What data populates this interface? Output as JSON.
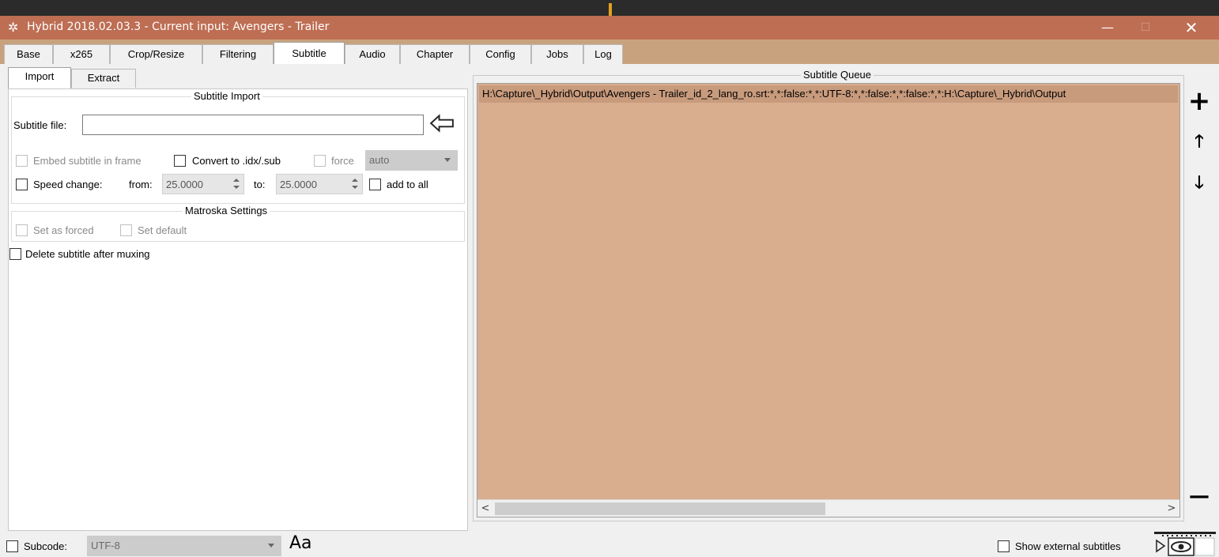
{
  "window": {
    "title": "Hybrid 2018.02.03.3 - Current input: Avengers - Trailer",
    "app_icon": "hybrid-app-icon",
    "controls": {
      "minimize": "—",
      "maximize": "☐",
      "close": "✕"
    }
  },
  "main_tabs": [
    {
      "label": "Base"
    },
    {
      "label": "x265"
    },
    {
      "label": "Crop/Resize"
    },
    {
      "label": "Filtering"
    },
    {
      "label": "Subtitle"
    },
    {
      "label": "Audio"
    },
    {
      "label": "Chapter"
    },
    {
      "label": "Config"
    },
    {
      "label": "Jobs"
    },
    {
      "label": "Log"
    }
  ],
  "active_tab": "Subtitle",
  "sub_tabs": [
    {
      "label": "Import"
    },
    {
      "label": "Extract"
    }
  ],
  "import": {
    "group_title": "Subtitle Import",
    "subtitle_file_label": "Subtitle file:",
    "subtitle_file_value": "",
    "embed_label": "Embed subtitle in frame",
    "convert_label": "Convert to .idx/.sub",
    "force_label": "force",
    "force_combo_value": "auto",
    "speed_label": "Speed change:",
    "from_label": "from:",
    "from_value": "25.0000",
    "to_label": "to:",
    "to_value": "25.0000",
    "add_to_all_label": "add to all",
    "matroska_title": "Matroska Settings",
    "set_forced_label": "Set as forced",
    "set_default_label": "Set default",
    "delete_label": "Delete subtitle after muxing"
  },
  "queue": {
    "title": "Subtitle Queue",
    "items": [
      "H:\\Capture\\_Hybrid\\Output\\Avengers - Trailer_id_2_lang_ro.srt:*,*:false:*,*:UTF-8:*,*:false:*,*:false:*,*:H:\\Capture\\_Hybrid\\Output"
    ],
    "scroll_left": "<",
    "scroll_right": ">"
  },
  "side_buttons": {
    "add": "+",
    "up": "🡑",
    "down": "🡓",
    "remove": "—"
  },
  "bottom": {
    "subcode_label": "Subcode:",
    "subcode_value": "UTF-8",
    "font_icon_text": "Aa",
    "show_external_label": "Show external subtitles"
  },
  "colors": {
    "titlebar": "#bd6e53",
    "tabbar": "#c8a27e",
    "queue_bg": "#d8ae8f",
    "queue_row": "#c99b7d"
  }
}
